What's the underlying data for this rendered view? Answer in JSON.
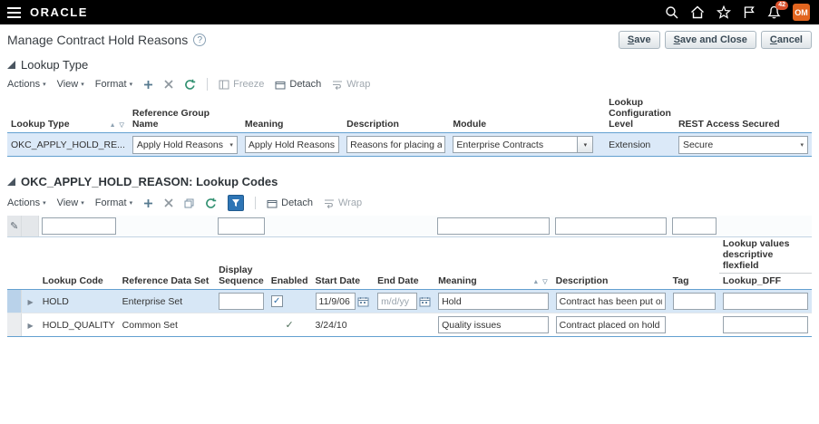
{
  "topbar": {
    "brand": "ORACLE",
    "notification_count": "42",
    "avatar_initials": "OM"
  },
  "page": {
    "title": "Manage Contract Hold Reasons",
    "help": "?",
    "buttons": {
      "save": "Save",
      "save_and_close": "Save and Close",
      "cancel": "Cancel"
    }
  },
  "icons": {
    "caret": "▾",
    "sort_asc": "▲",
    "sort_desc": "▽",
    "row_arrow": "▶",
    "pencil": "✎",
    "check": "✓",
    "lov_arrow": "▾",
    "select_chevron": "▾"
  },
  "lookup_type": {
    "title": "Lookup Type",
    "toolbar": {
      "actions": "Actions",
      "view": "View",
      "format": "Format",
      "freeze": "Freeze",
      "detach": "Detach",
      "wrap": "Wrap"
    },
    "columns": [
      "Lookup Type",
      "Reference Group Name",
      "Meaning",
      "Description",
      "Module",
      "Lookup Configuration Level",
      "REST Access Secured"
    ],
    "row": {
      "lookup_type": "OKC_APPLY_HOLD_RE...",
      "reference_group_name": "Apply Hold Reasons",
      "meaning": "Apply Hold Reasons",
      "description": "Reasons for placing a contract on hold.",
      "module": "Enterprise Contracts",
      "lookup_configuration_level": "Extension",
      "rest_access_secured": "Secure"
    }
  },
  "lookup_codes": {
    "title": "OKC_APPLY_HOLD_REASON: Lookup Codes",
    "toolbar": {
      "actions": "Actions",
      "view": "View",
      "format": "Format",
      "detach": "Detach",
      "wrap": "Wrap"
    },
    "columns": [
      "Lookup Code",
      "Reference Data Set",
      "Display Sequence",
      "Enabled",
      "Start Date",
      "End Date",
      "Meaning",
      "Description",
      "Tag"
    ],
    "dff_header": "Lookup values descriptive flexfield",
    "dff_subheader": "Lookup_DFF",
    "rows": [
      {
        "lookup_code": "HOLD",
        "reference_data_set": "Enterprise Set",
        "display_sequence": "",
        "enabled": true,
        "start_date": "11/9/06",
        "end_date": "",
        "end_date_placeholder": "m/d/yy",
        "meaning": "Hold",
        "description": "Contract has been put on hold to suspend ex",
        "tag": "",
        "lookup_dff": ""
      },
      {
        "lookup_code": "HOLD_QUALITY",
        "reference_data_set": "Common Set",
        "display_sequence": "",
        "enabled": true,
        "start_date": "3/24/10",
        "end_date": "",
        "meaning": "Quality issues",
        "description": "Contract placed on hold due to quality issues",
        "tag": "",
        "lookup_dff": ""
      }
    ]
  },
  "colors": {
    "topbar_bg": "#000000",
    "accent_blue": "#2e75b5",
    "selected_row": "#d7e7f6",
    "header_rule": "#63a0d0",
    "avatar_bg": "#e2651f",
    "badge_bg": "#d9502c"
  }
}
